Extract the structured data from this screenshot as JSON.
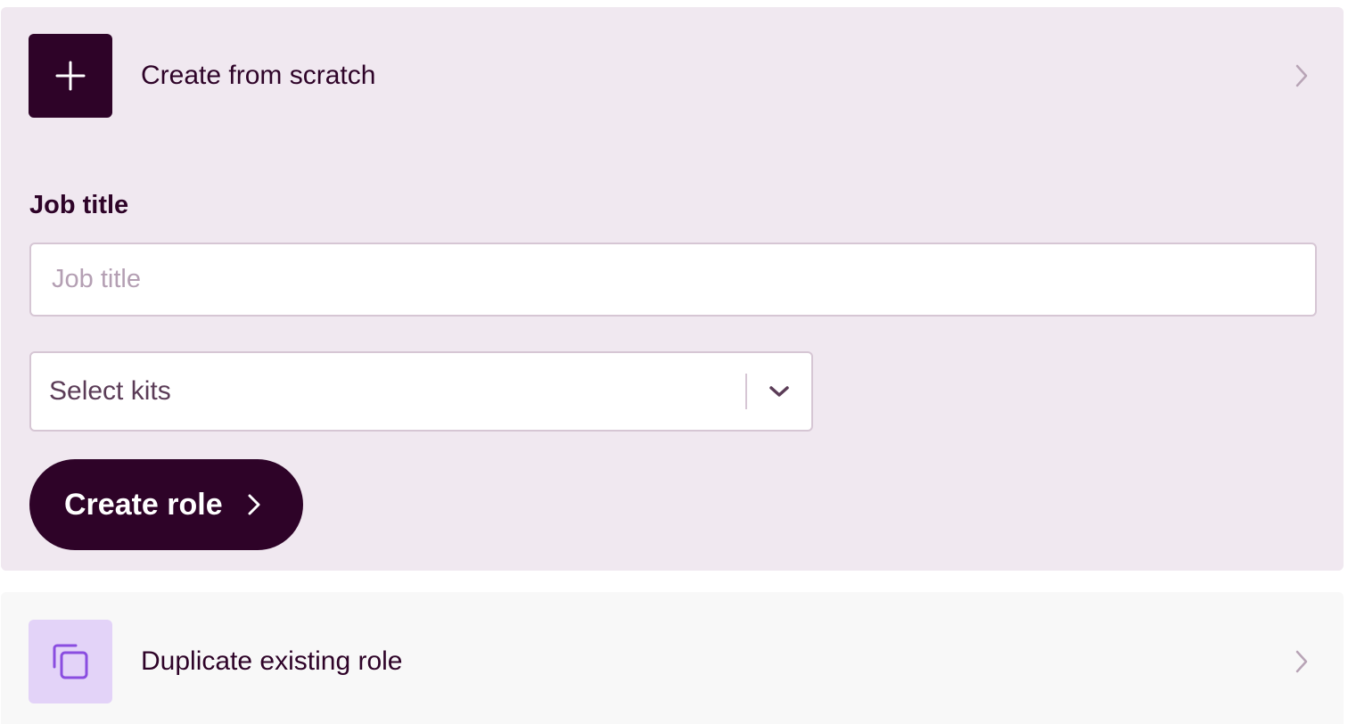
{
  "create_card": {
    "title": "Create from scratch",
    "icon": "plus-icon",
    "expanded": true,
    "job_title": {
      "label": "Job title",
      "placeholder": "Job title",
      "value": ""
    },
    "kits_select": {
      "selected": "Select kits",
      "caret_icon": "chevron-down-icon"
    },
    "submit_label": "Create role",
    "submit_icon": "chevron-right-icon"
  },
  "duplicate_card": {
    "title": "Duplicate existing role",
    "icon": "copy-icon",
    "expanded": false
  },
  "colors": {
    "brand_dark": "#2e0328",
    "expanded_card_bg": "#f0e8f0",
    "collapsed_card_bg": "#f8f8f8",
    "copy_icon_tile": "#e3d3f8",
    "copy_icon_stroke": "#8a4de0",
    "border": "#d6c6d4"
  }
}
